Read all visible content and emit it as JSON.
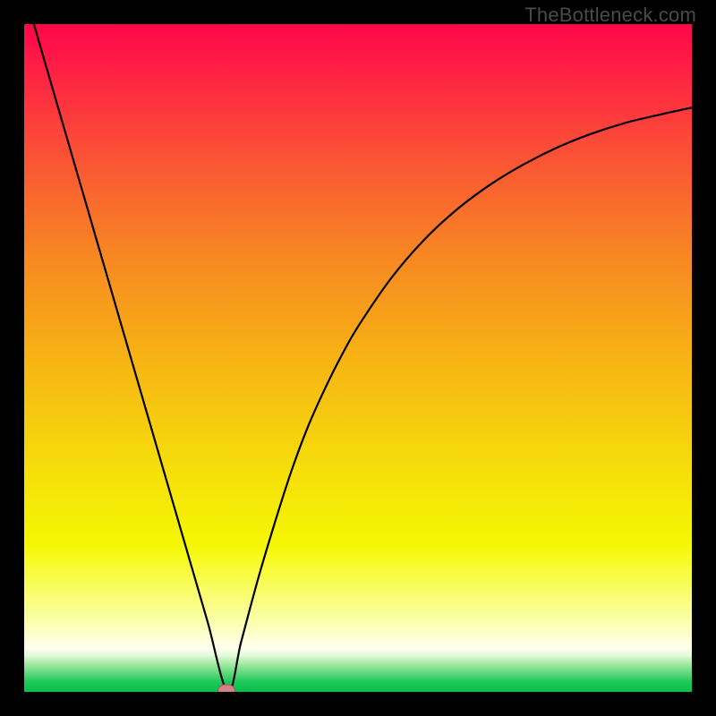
{
  "watermark": "TheBottleneck.com",
  "chart_data": {
    "type": "line",
    "title": "",
    "xlabel": "",
    "ylabel": "",
    "xlim": [
      0,
      100
    ],
    "ylim": [
      0,
      100
    ],
    "series": [
      {
        "name": "curve",
        "x": [
          0.0,
          2.5,
          5.0,
          7.5,
          10.0,
          12.5,
          15.0,
          17.5,
          20.0,
          22.5,
          25.0,
          27.5,
          30.5,
          32.5,
          35.0,
          37.5,
          40.0,
          42.5,
          45.0,
          47.5,
          50.0,
          55.0,
          60.0,
          65.0,
          70.0,
          75.0,
          80.0,
          85.0,
          90.0,
          95.0,
          100.0
        ],
        "y": [
          105.0,
          96.4,
          87.8,
          79.2,
          70.6,
          62.0,
          53.4,
          44.8,
          36.2,
          27.6,
          19.0,
          10.4,
          0.0,
          7.5,
          16.8,
          25.2,
          33.0,
          39.7,
          45.3,
          50.3,
          54.7,
          62.0,
          67.8,
          72.4,
          76.1,
          79.1,
          81.6,
          83.6,
          85.2,
          86.4,
          87.5
        ]
      }
    ],
    "marker": {
      "x": 30.3,
      "y": 0.2
    },
    "gradient_stops": [
      {
        "offset": 0.0,
        "color": "#ff074a"
      },
      {
        "offset": 0.05,
        "color": "#ff1946"
      },
      {
        "offset": 0.2,
        "color": "#fb5335"
      },
      {
        "offset": 0.35,
        "color": "#f78822"
      },
      {
        "offset": 0.5,
        "color": "#f7b314"
      },
      {
        "offset": 0.65,
        "color": "#f6da0c"
      },
      {
        "offset": 0.78,
        "color": "#f5f703"
      },
      {
        "offset": 0.8,
        "color": "#f7fb20"
      },
      {
        "offset": 0.9,
        "color": "#fbffb4"
      },
      {
        "offset": 0.935,
        "color": "#feffef"
      },
      {
        "offset": 0.945,
        "color": "#e4fadb"
      },
      {
        "offset": 0.96,
        "color": "#9be79e"
      },
      {
        "offset": 0.985,
        "color": "#1fc85a"
      },
      {
        "offset": 1.0,
        "color": "#03c148"
      }
    ]
  }
}
